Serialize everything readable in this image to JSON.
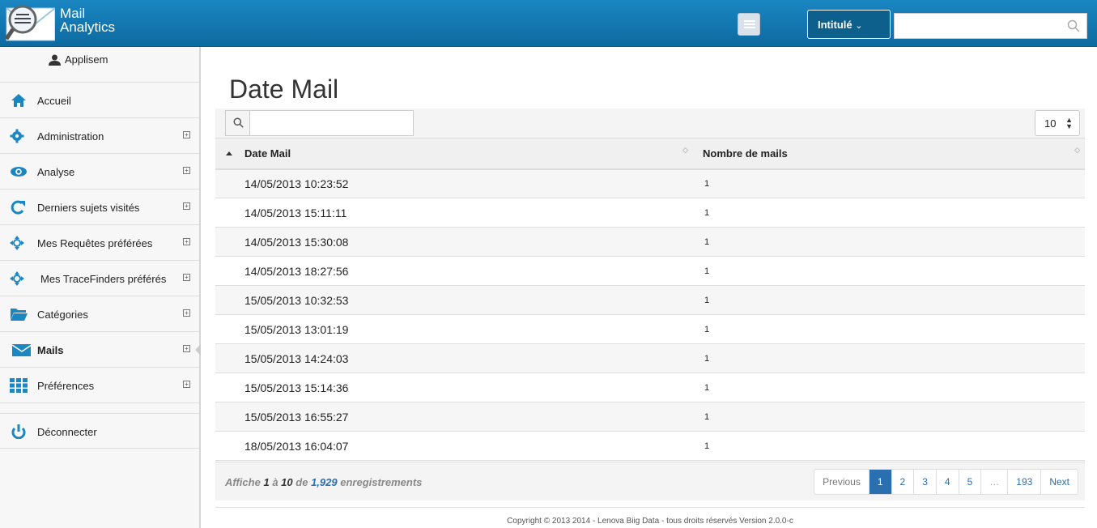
{
  "header": {
    "brand_line1": "Mail",
    "brand_line2": "Analytics",
    "intitule_label": "Intitulé",
    "search_placeholder": ""
  },
  "sidebar": {
    "user_name": "Applisem",
    "items": [
      {
        "label": "Accueil",
        "icon": "home-icon",
        "expandable": false
      },
      {
        "label": "Administration",
        "icon": "gear-icon",
        "expandable": true
      },
      {
        "label": "Analyse",
        "icon": "eye-icon",
        "expandable": true
      },
      {
        "label": "Derniers sujets visités",
        "icon": "refresh-icon",
        "expandable": true
      },
      {
        "label": "Mes Requêtes préférées",
        "icon": "crosshair-icon",
        "expandable": true
      },
      {
        "label": "Mes TraceFinders préférés",
        "icon": "crosshair-icon",
        "expandable": true
      },
      {
        "label": "Catégories",
        "icon": "folder-icon",
        "expandable": true
      },
      {
        "label": "Mails",
        "icon": "envelope-icon",
        "expandable": true,
        "active": true
      },
      {
        "label": "Préférences",
        "icon": "grid-icon",
        "expandable": true
      }
    ],
    "logout_label": "Déconnecter"
  },
  "main": {
    "title": "Date Mail",
    "table_search_value": "",
    "page_size": "10",
    "columns": [
      "Date Mail",
      "Nombre de mails"
    ],
    "rows": [
      [
        "14/05/2013 10:23:52",
        "1"
      ],
      [
        "14/05/2013 15:11:11",
        "1"
      ],
      [
        "14/05/2013 15:30:08",
        "1"
      ],
      [
        "14/05/2013 18:27:56",
        "1"
      ],
      [
        "15/05/2013 10:32:53",
        "1"
      ],
      [
        "15/05/2013 13:01:19",
        "1"
      ],
      [
        "15/05/2013 14:24:03",
        "1"
      ],
      [
        "15/05/2013 15:14:36",
        "1"
      ],
      [
        "15/05/2013 16:55:27",
        "1"
      ],
      [
        "18/05/2013 16:04:07",
        "1"
      ]
    ],
    "info": {
      "prefix": "Affiche",
      "from": "1",
      "mid": "à",
      "to": "10",
      "de": "de",
      "total": "1,929",
      "suffix": "enregistrements"
    },
    "pagination": {
      "previous": "Previous",
      "pages": [
        "1",
        "2",
        "3",
        "4",
        "5",
        "…",
        "193"
      ],
      "active_page": "1",
      "next": "Next"
    }
  },
  "footer": {
    "copyright": "Copyright © 2013 2014 - Lenova Biig Data - tous droits réservés Version 2.0.0-c"
  },
  "colors": {
    "topbar": "#1a86c2",
    "accent": "#2a6fb0",
    "icon_blue": "#1a86c2"
  }
}
